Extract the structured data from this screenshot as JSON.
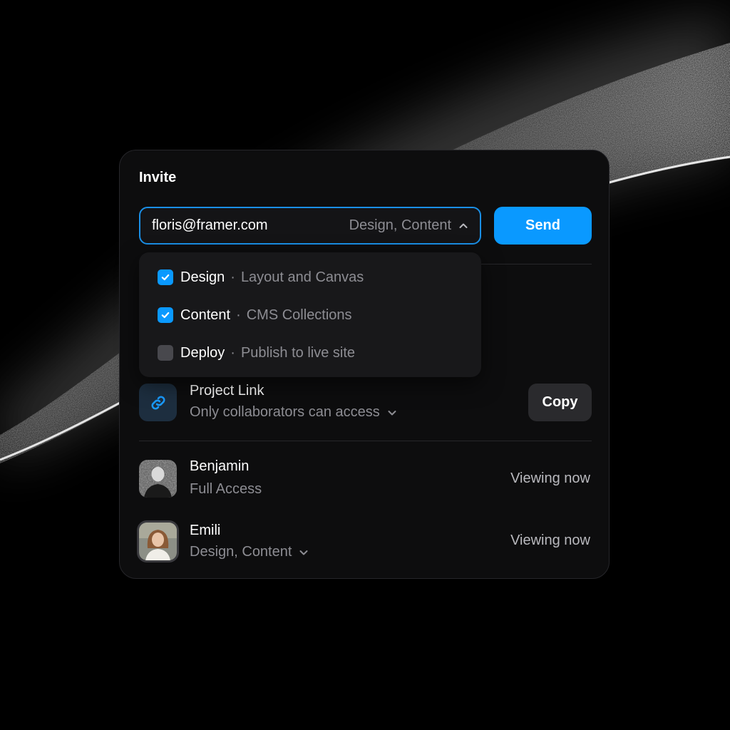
{
  "invite": {
    "title": "Invite",
    "email_value": "floris@framer.com",
    "roles_summary": "Design, Content",
    "send_label": "Send",
    "options": [
      {
        "label": "Design",
        "separator": "·",
        "description": "Layout and Canvas",
        "checked": true
      },
      {
        "label": "Content",
        "separator": "·",
        "description": "CMS Collections",
        "checked": true
      },
      {
        "label": "Deploy",
        "separator": "·",
        "description": "Publish to live site",
        "checked": false
      }
    ]
  },
  "project_link": {
    "title": "Project Link",
    "access": "Only collaborators can access",
    "copy_label": "Copy"
  },
  "collaborators": [
    {
      "name": "Benjamin",
      "role": "Full Access",
      "status": "Viewing now"
    },
    {
      "name": "Emili",
      "role": "Design, Content",
      "status": "Viewing now"
    }
  ],
  "colors": {
    "accent": "#0a99ff",
    "card_background": "#0d0d0e",
    "muted_text": "#8d8d93"
  },
  "icons": {
    "chevron_up": "chevron-up-icon",
    "check": "check-icon",
    "link": "link-icon",
    "chevron_down": "chevron-down-icon"
  }
}
